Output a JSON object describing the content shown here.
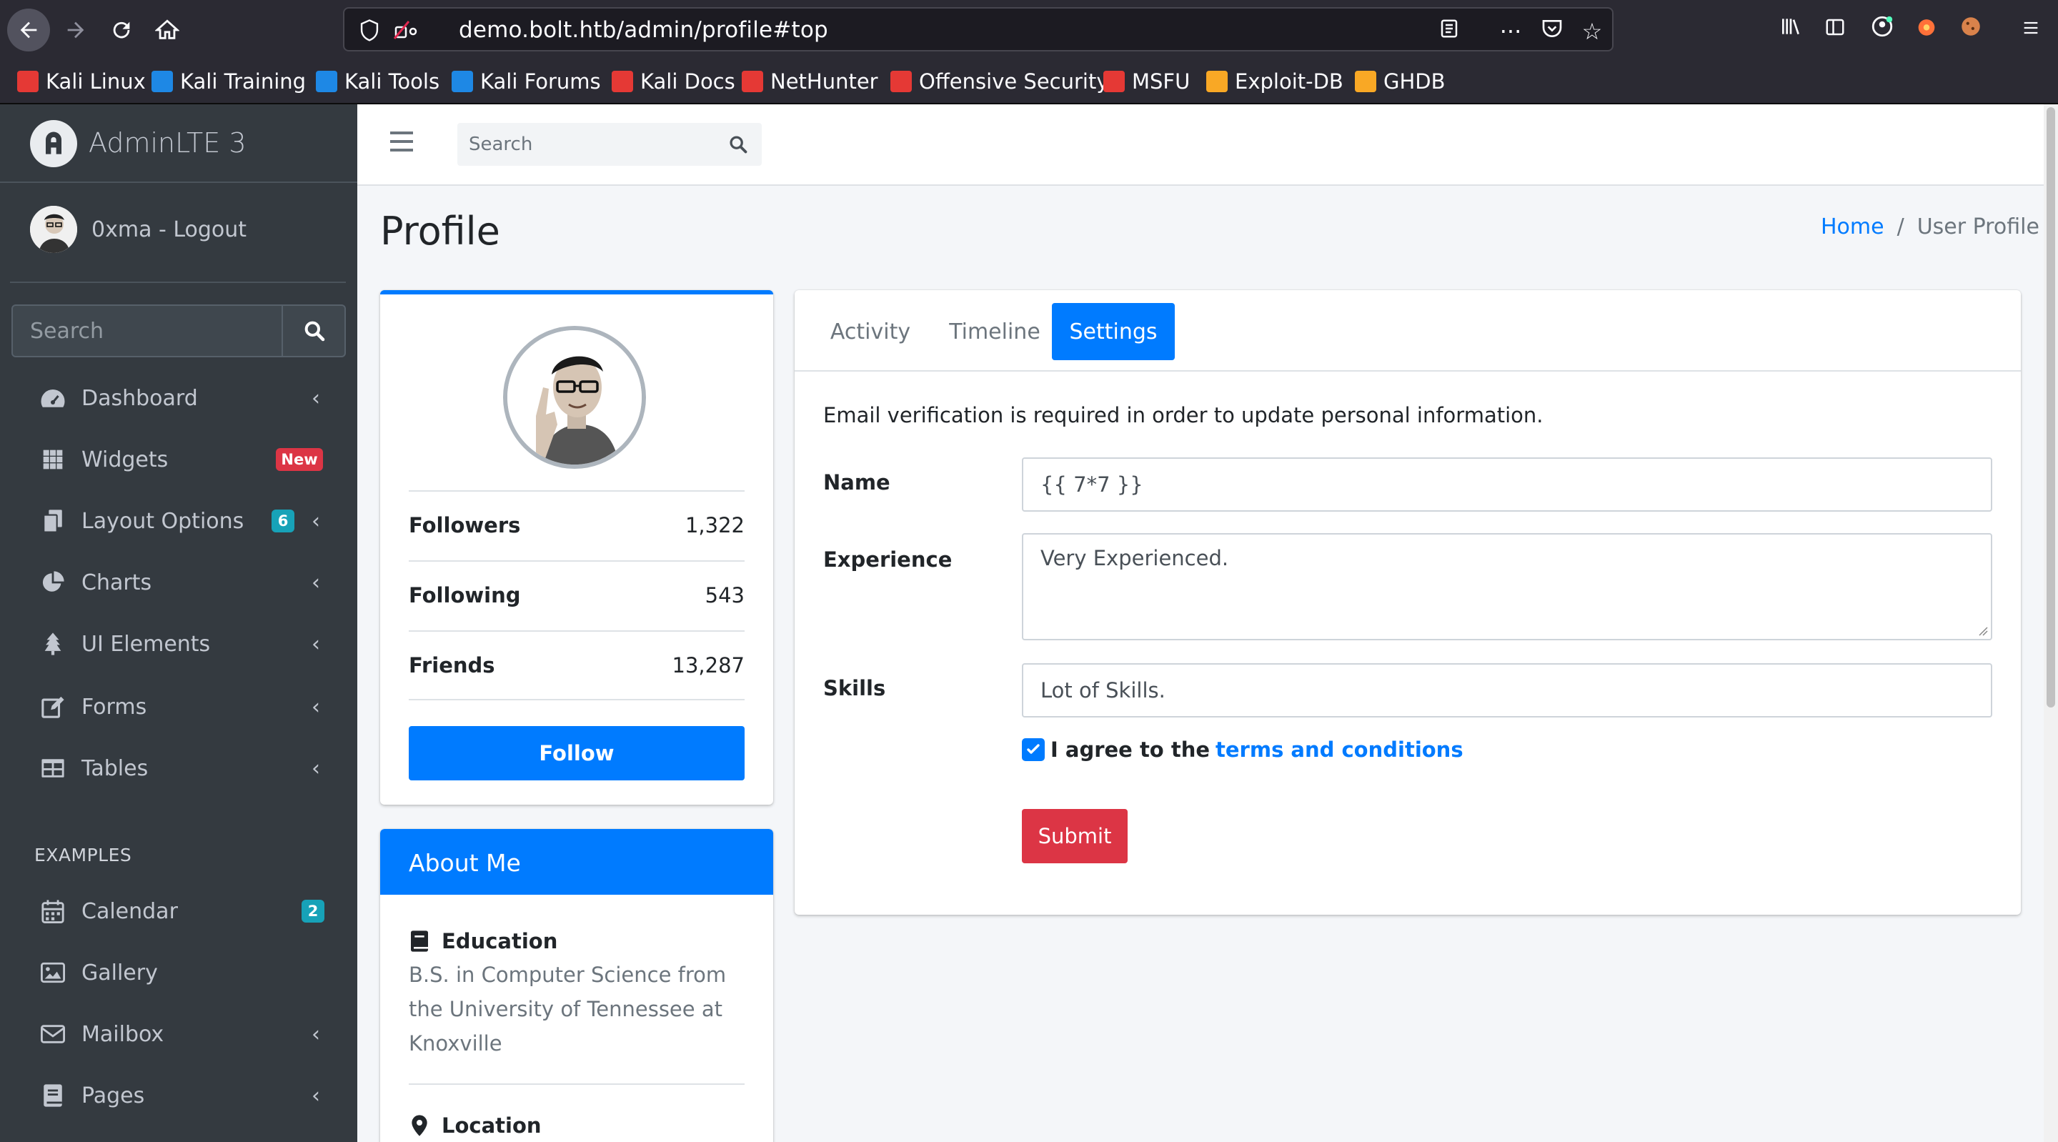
{
  "browser": {
    "url": "demo.bolt.htb/admin/profile#top",
    "bookmarks": [
      {
        "label": "Kali Linux",
        "color": "#e53935"
      },
      {
        "label": "Kali Training",
        "color": "#1e88e5"
      },
      {
        "label": "Kali Tools",
        "color": "#1e88e5"
      },
      {
        "label": "Kali Forums",
        "color": "#1e88e5"
      },
      {
        "label": "Kali Docs",
        "color": "#e53935"
      },
      {
        "label": "NetHunter",
        "color": "#e53935"
      },
      {
        "label": "Offensive Security",
        "color": "#e53935"
      },
      {
        "label": "MSFU",
        "color": "#e53935"
      },
      {
        "label": "Exploit-DB",
        "color": "#f9a825"
      },
      {
        "label": "GHDB",
        "color": "#f9a825"
      }
    ]
  },
  "sidebar": {
    "brand": "AdminLTE 3",
    "user": "0xma - Logout",
    "search_placeholder": "Search",
    "items": [
      {
        "label": "Dashboard",
        "icon": "dashboard-icon"
      },
      {
        "label": "Widgets",
        "icon": "grid-icon",
        "badge": "New"
      },
      {
        "label": "Layout Options",
        "icon": "copy-icon",
        "badge": "6"
      },
      {
        "label": "Charts",
        "icon": "pie-chart-icon"
      },
      {
        "label": "UI Elements",
        "icon": "tree-icon"
      },
      {
        "label": "Forms",
        "icon": "edit-icon"
      },
      {
        "label": "Tables",
        "icon": "table-icon"
      }
    ],
    "examples_header": "EXAMPLES",
    "examples": [
      {
        "label": "Calendar",
        "icon": "calendar-icon",
        "badge": "2"
      },
      {
        "label": "Gallery",
        "icon": "image-icon"
      },
      {
        "label": "Mailbox",
        "icon": "envelope-icon"
      },
      {
        "label": "Pages",
        "icon": "book-icon"
      }
    ]
  },
  "header": {
    "search_placeholder": "Search"
  },
  "page": {
    "title": "Profile",
    "breadcrumb_home": "Home",
    "breadcrumb_current": "User Profile"
  },
  "profile": {
    "stats": [
      {
        "label": "Followers",
        "value": "1,322"
      },
      {
        "label": "Following",
        "value": "543"
      },
      {
        "label": "Friends",
        "value": "13,287"
      }
    ],
    "follow_label": "Follow"
  },
  "about": {
    "title": "About Me",
    "education_title": "Education",
    "education_text": "B.S. in Computer Science from the University of Tennessee at Knoxville",
    "location_title": "Location"
  },
  "settings": {
    "tabs": [
      "Activity",
      "Timeline",
      "Settings"
    ],
    "active_tab": "Settings",
    "notice": "Email verification is required in order to update personal information.",
    "name_label": "Name",
    "name_value": "{{ 7*7 }}",
    "experience_label": "Experience",
    "experience_value": "Very Experienced.",
    "skills_label": "Skills",
    "skills_value": "Lot of Skills.",
    "agree_text": "I agree to the",
    "terms_link": "terms and conditions",
    "agree_checked": true,
    "submit_label": "Submit"
  }
}
